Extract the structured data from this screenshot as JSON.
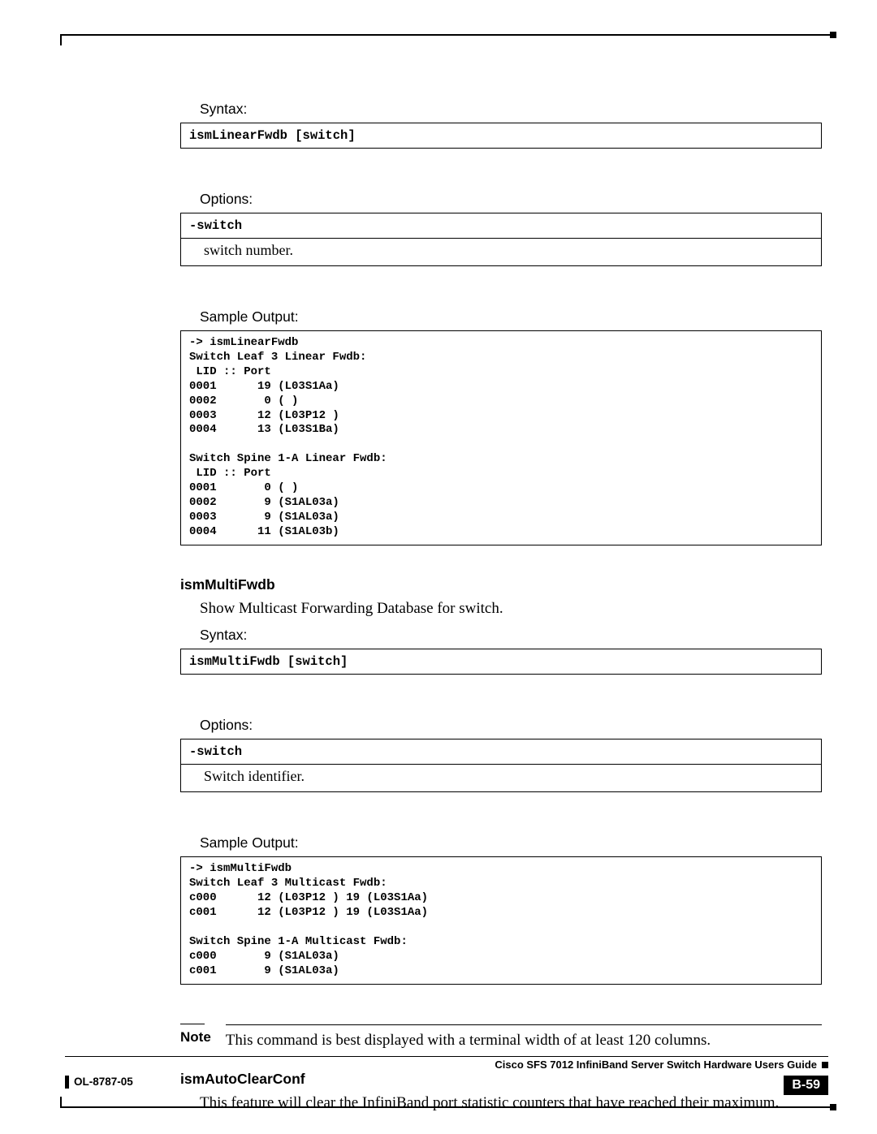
{
  "sections": {
    "ismLinearFwdb": {
      "syntax_label": "Syntax:",
      "syntax_code": "ismLinearFwdb [switch]",
      "options_label": "Options:",
      "option_name": "-switch",
      "option_desc": "switch number.",
      "sample_label": "Sample Output:",
      "sample_output": "-> ismLinearFwdb\nSwitch Leaf 3 Linear Fwdb:\n LID :: Port\n0001      19 (L03S1Aa)\n0002       0 ( )\n0003      12 (L03P12 )\n0004      13 (L03S1Ba)\n\nSwitch Spine 1-A Linear Fwdb:\n LID :: Port\n0001       0 ( )\n0002       9 (S1AL03a)\n0003       9 (S1AL03a)\n0004      11 (S1AL03b)"
    },
    "ismMultiFwdb": {
      "heading": "ismMultiFwdb",
      "description": "Show Multicast Forwarding Database for switch.",
      "syntax_label": "Syntax:",
      "syntax_code": "ismMultiFwdb [switch]",
      "options_label": "Options:",
      "option_name": "-switch",
      "option_desc": "Switch identifier.",
      "sample_label": "Sample Output:",
      "sample_output": "-> ismMultiFwdb\nSwitch Leaf 3 Multicast Fwdb:\nc000      12 (L03P12 ) 19 (L03S1Aa)\nc001      12 (L03P12 ) 19 (L03S1Aa)\n\nSwitch Spine 1-A Multicast Fwdb:\nc000       9 (S1AL03a)\nc001       9 (S1AL03a)"
    },
    "note": {
      "label": "Note",
      "text": "This command is best displayed with a terminal width of at least 120 columns."
    },
    "ismAutoClearConf": {
      "heading": "ismAutoClearConf",
      "description": "This feature will clear the InfiniBand port statistic counters that have reached their maximum."
    }
  },
  "footer": {
    "title": "Cisco SFS 7012 InfiniBand Server Switch Hardware Users Guide",
    "doc_id": "OL-8787-05",
    "page": "B-59"
  }
}
